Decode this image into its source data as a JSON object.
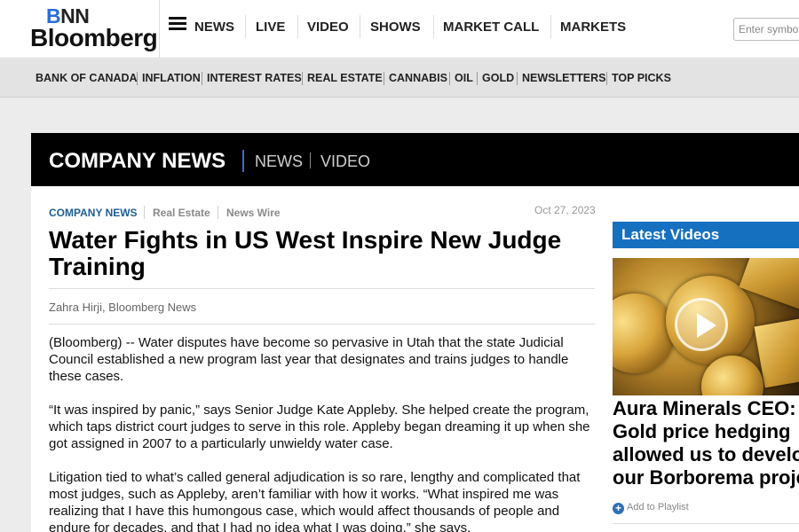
{
  "header": {
    "logo_top": "BNN",
    "logo_bottom": "Bloomberg",
    "nav": [
      "NEWS",
      "LIVE",
      "VIDEO",
      "SHOWS",
      "MARKET CALL",
      "MARKETS"
    ],
    "search_placeholder": "Enter symbol"
  },
  "subnav": [
    "BANK OF CANADA",
    "INFLATION",
    "INTEREST RATES",
    "REAL ESTATE",
    "CANNABIS",
    "OIL",
    "GOLD",
    "NEWSLETTERS",
    "TOP PICKS"
  ],
  "section": {
    "title": "COMPANY NEWS",
    "links": [
      "NEWS",
      "VIDEO"
    ]
  },
  "article": {
    "categories": [
      "COMPANY NEWS",
      "Real Estate",
      "News Wire"
    ],
    "date": "Oct 27, 2023",
    "headline": "Water Fights in US West Inspire New Judge Training",
    "byline": "Zahra Hirji, Bloomberg News",
    "paragraphs": [
      "(Bloomberg) -- Water disputes have become so pervasive in Utah that the state Judicial Council established a new program last year that designates and trains judges to handle these cases.",
      "“It was inspired by panic,” says Senior Judge Kate Appleby. She helped create the program, which taps district court judges to serve in this role. Appleby began dreaming it up when she got assigned in 2007 to a particularly unwieldy water case.",
      "Litigation tied to what’s called general adjudication is so rare, lengthy and complicated that most judges, such as Appleby, aren’t familiar with how it works. “What inspired me was realizing that I have this humongous case, which would affect thousands of people and endure for decades, and that I had no idea what I was doing,” she says."
    ]
  },
  "sidebar": {
    "heading": "Latest Videos",
    "video_title": "Aura Minerals CEO: Gold price hedging allowed us to develop our Borborema project",
    "add_playlist": "Add to Playlist"
  },
  "colors": {
    "accent_blue": "#1670c0",
    "category_blue": "#1d5e95",
    "section_bg": "#000000"
  }
}
